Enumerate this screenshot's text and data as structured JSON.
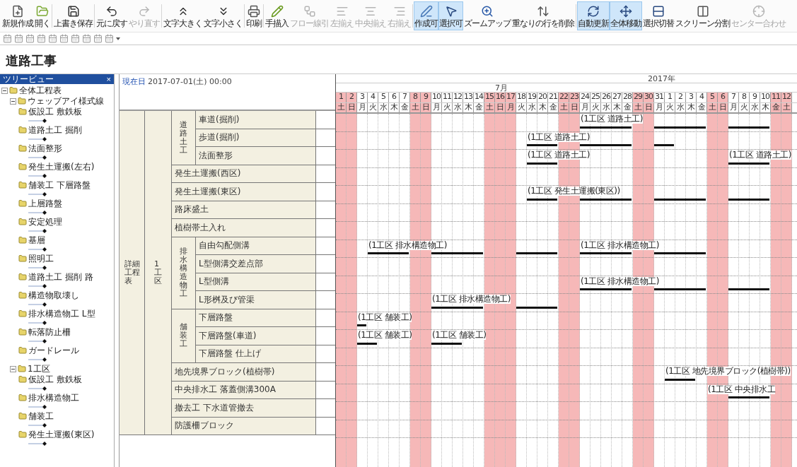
{
  "toolbar": {
    "buttons": [
      {
        "label": "新規作成",
        "disabled": false,
        "selected": false
      },
      {
        "label": "開く",
        "disabled": false,
        "selected": false
      },
      {
        "label": "上書き保存",
        "disabled": false,
        "selected": false
      },
      {
        "label": "元に戻す",
        "disabled": false,
        "selected": false
      },
      {
        "label": "やり直す",
        "disabled": true,
        "selected": false
      },
      {
        "label": "文字大きく",
        "disabled": false,
        "selected": false
      },
      {
        "label": "文字小さく",
        "disabled": false,
        "selected": false
      },
      {
        "label": "印刷",
        "disabled": false,
        "selected": false
      },
      {
        "label": "手描入",
        "disabled": false,
        "selected": false
      },
      {
        "label": "フロー線引",
        "disabled": true,
        "selected": false
      },
      {
        "label": "左揃え",
        "disabled": true,
        "selected": false
      },
      {
        "label": "中央揃え",
        "disabled": true,
        "selected": false
      },
      {
        "label": "右揃え",
        "disabled": true,
        "selected": false
      },
      {
        "label": "作成可",
        "disabled": false,
        "selected": true
      },
      {
        "label": "選択可",
        "disabled": false,
        "selected": true
      },
      {
        "label": "ズームアップ",
        "disabled": false,
        "selected": false
      },
      {
        "label": "重なりの行を削除",
        "disabled": false,
        "selected": false
      },
      {
        "label": "自動更新",
        "disabled": false,
        "selected": true
      },
      {
        "label": "全体移動",
        "disabled": false,
        "selected": true
      },
      {
        "label": "選択切替",
        "disabled": false,
        "selected": false
      },
      {
        "label": "スクリーン分割",
        "disabled": false,
        "selected": false
      },
      {
        "label": "センター合わせ",
        "disabled": true,
        "selected": false
      }
    ]
  },
  "title": "道路工事",
  "tree": {
    "header": "ツリービュー",
    "close": "×",
    "items": [
      {
        "label": "全体工程表",
        "expanded": true,
        "children": [
          {
            "label": "ウェッブアイ様式線",
            "expanded": true,
            "children": [
              {
                "label": "仮設工 敷鉄板"
              },
              {
                "label": "道路土工 掘削"
              },
              {
                "label": "法面整形"
              },
              {
                "label": "発生土運搬(左右)"
              },
              {
                "label": "舗装工 下層路盤"
              },
              {
                "label": "上層路盤"
              },
              {
                "label": "安定処理"
              },
              {
                "label": "基層"
              },
              {
                "label": "照明工"
              },
              {
                "label": "道路土工 掘削 路"
              },
              {
                "label": "構造物取壊し"
              },
              {
                "label": "排水構造物工 L型"
              },
              {
                "label": "転落防止柵"
              },
              {
                "label": "ガードレール"
              }
            ]
          },
          {
            "label": "1工区",
            "expanded": true,
            "children": [
              {
                "label": "仮設工 敷鉄板"
              },
              {
                "label": "排水構造物工"
              },
              {
                "label": "舗装工"
              },
              {
                "label": "発生土運搬(東区)"
              }
            ]
          }
        ]
      }
    ]
  },
  "table": {
    "current_label": "現在日",
    "current_date": "2017-07-01(土) 00:00",
    "level1": "詳細工程表",
    "level2": "1工区",
    "rows": [
      {
        "kind": "group",
        "name": "道路土工",
        "items": [
          {
            "name": "車道(掘削)",
            "bars": [
              {
                "label": "(1工区 道路土工)"
              }
            ]
          },
          {
            "name": "歩道(掘削)",
            "bars": [
              {
                "label": "(1工区 道路土工)"
              }
            ]
          },
          {
            "name": "法面整形",
            "bars": [
              {
                "label": "(1工区 道路土工)"
              },
              {
                "label": "(1工区 道路土工)"
              }
            ]
          }
        ]
      },
      {
        "kind": "task",
        "name": "発生土運搬(西区)"
      },
      {
        "kind": "task",
        "name": "発生土運搬(東区)",
        "bars": [
          {
            "label": "(1工区 発生土運搬(東区))"
          }
        ]
      },
      {
        "kind": "task",
        "name": "路床盛土"
      },
      {
        "kind": "task",
        "name": "植樹帯土入れ"
      },
      {
        "kind": "group",
        "name": "排水構造物工",
        "items": [
          {
            "name": "自由勾配側溝",
            "bars": [
              {
                "label": "(1工区 排水構造物工)"
              },
              {
                "label": "(1工区 排水構造物工)"
              }
            ]
          },
          {
            "name": "L型側溝交差点部"
          },
          {
            "name": "L型側溝",
            "bars": [
              {
                "label": "(1工区 排水構造物工)"
              }
            ]
          },
          {
            "name": "L形桝及び管渠",
            "bars": [
              {
                "label": "(1工区 排水構造物工)"
              }
            ]
          }
        ]
      },
      {
        "kind": "group",
        "name": "舗装工",
        "items": [
          {
            "name": "下層路盤",
            "bars": [
              {
                "label": "(1工区 舗装工)"
              }
            ]
          },
          {
            "name": "下層路盤(車道)",
            "bars": [
              {
                "label": "(1工区 舗装工)"
              },
              {
                "label": "(1工区 舗装工)"
              }
            ]
          },
          {
            "name": "下層路盤 仕上げ"
          }
        ]
      },
      {
        "kind": "task",
        "name": "地先境界ブロック(植樹帯)",
        "bars": [
          {
            "label": "(1工区 地先境界ブロック(植樹帯))"
          }
        ]
      },
      {
        "kind": "task",
        "name": "中央排水工 落蓋側溝300A",
        "bars": [
          {
            "label": "(1工区 中央排水工"
          }
        ]
      },
      {
        "kind": "task",
        "name": "撤去工 下水道管撤去"
      },
      {
        "kind": "task",
        "name": "防護柵ブロック"
      }
    ]
  },
  "timeline": {
    "year": "2017年",
    "month": "7月",
    "days": [
      {
        "day": "1",
        "weekday": "土",
        "weekend": true
      },
      {
        "day": "2",
        "weekday": "日",
        "weekend": true
      },
      {
        "day": "3",
        "weekday": "月",
        "weekend": false
      },
      {
        "day": "4",
        "weekday": "火",
        "weekend": false
      },
      {
        "day": "5",
        "weekday": "水",
        "weekend": false
      },
      {
        "day": "6",
        "weekday": "木",
        "weekend": false
      },
      {
        "day": "7",
        "weekday": "金",
        "weekend": false
      },
      {
        "day": "8",
        "weekday": "土",
        "weekend": true
      },
      {
        "day": "9",
        "weekday": "日",
        "weekend": true
      },
      {
        "day": "10",
        "weekday": "月",
        "weekend": false
      },
      {
        "day": "11",
        "weekday": "火",
        "weekend": false
      },
      {
        "day": "12",
        "weekday": "水",
        "weekend": false
      },
      {
        "day": "13",
        "weekday": "木",
        "weekend": false
      },
      {
        "day": "14",
        "weekday": "金",
        "weekend": false
      },
      {
        "day": "15",
        "weekday": "土",
        "weekend": true
      },
      {
        "day": "16",
        "weekday": "日",
        "weekend": true
      },
      {
        "day": "17",
        "weekday": "月",
        "weekend": true
      },
      {
        "day": "18",
        "weekday": "火",
        "weekend": false
      },
      {
        "day": "19",
        "weekday": "水",
        "weekend": false
      },
      {
        "day": "20",
        "weekday": "木",
        "weekend": false
      },
      {
        "day": "21",
        "weekday": "金",
        "weekend": false
      },
      {
        "day": "22",
        "weekday": "土",
        "weekend": true
      },
      {
        "day": "23",
        "weekday": "日",
        "weekend": true
      },
      {
        "day": "24",
        "weekday": "月",
        "weekend": false
      },
      {
        "day": "25",
        "weekday": "火",
        "weekend": false
      },
      {
        "day": "26",
        "weekday": "水",
        "weekend": false
      },
      {
        "day": "27",
        "weekday": "木",
        "weekend": false
      },
      {
        "day": "28",
        "weekday": "金",
        "weekend": false
      },
      {
        "day": "29",
        "weekday": "土",
        "weekend": true
      },
      {
        "day": "30",
        "weekday": "日",
        "weekend": true
      },
      {
        "day": "31",
        "weekday": "月",
        "weekend": false
      },
      {
        "day": "1",
        "weekday": "火",
        "weekend": false
      },
      {
        "day": "2",
        "weekday": "水",
        "weekend": false
      },
      {
        "day": "3",
        "weekday": "木",
        "weekend": false
      },
      {
        "day": "4",
        "weekday": "金",
        "weekend": false
      },
      {
        "day": "5",
        "weekday": "土",
        "weekend": true
      },
      {
        "day": "6",
        "weekday": "日",
        "weekend": true
      },
      {
        "day": "7",
        "weekday": "月",
        "weekend": false
      },
      {
        "day": "8",
        "weekday": "火",
        "weekend": false
      },
      {
        "day": "9",
        "weekday": "水",
        "weekend": false
      },
      {
        "day": "10",
        "weekday": "木",
        "weekend": false
      },
      {
        "day": "11",
        "weekday": "金",
        "weekend": true
      },
      {
        "day": "12",
        "weekday": "土",
        "weekend": true
      }
    ]
  }
}
